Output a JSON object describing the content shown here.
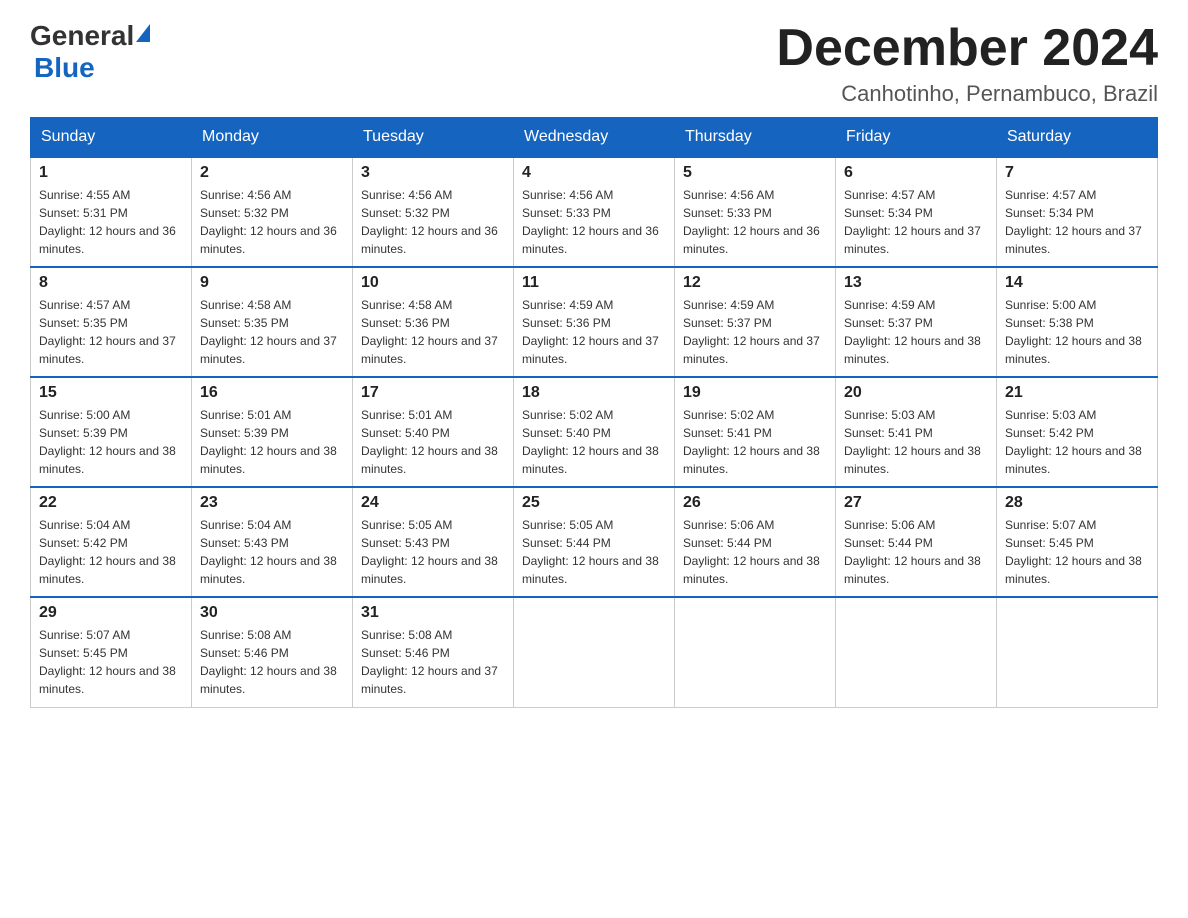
{
  "header": {
    "logo_general": "General",
    "logo_blue": "Blue",
    "month_title": "December 2024",
    "location": "Canhotinho, Pernambuco, Brazil"
  },
  "days_of_week": [
    "Sunday",
    "Monday",
    "Tuesday",
    "Wednesday",
    "Thursday",
    "Friday",
    "Saturday"
  ],
  "weeks": [
    [
      {
        "day": "1",
        "sunrise": "Sunrise: 4:55 AM",
        "sunset": "Sunset: 5:31 PM",
        "daylight": "Daylight: 12 hours and 36 minutes."
      },
      {
        "day": "2",
        "sunrise": "Sunrise: 4:56 AM",
        "sunset": "Sunset: 5:32 PM",
        "daylight": "Daylight: 12 hours and 36 minutes."
      },
      {
        "day": "3",
        "sunrise": "Sunrise: 4:56 AM",
        "sunset": "Sunset: 5:32 PM",
        "daylight": "Daylight: 12 hours and 36 minutes."
      },
      {
        "day": "4",
        "sunrise": "Sunrise: 4:56 AM",
        "sunset": "Sunset: 5:33 PM",
        "daylight": "Daylight: 12 hours and 36 minutes."
      },
      {
        "day": "5",
        "sunrise": "Sunrise: 4:56 AM",
        "sunset": "Sunset: 5:33 PM",
        "daylight": "Daylight: 12 hours and 36 minutes."
      },
      {
        "day": "6",
        "sunrise": "Sunrise: 4:57 AM",
        "sunset": "Sunset: 5:34 PM",
        "daylight": "Daylight: 12 hours and 37 minutes."
      },
      {
        "day": "7",
        "sunrise": "Sunrise: 4:57 AM",
        "sunset": "Sunset: 5:34 PM",
        "daylight": "Daylight: 12 hours and 37 minutes."
      }
    ],
    [
      {
        "day": "8",
        "sunrise": "Sunrise: 4:57 AM",
        "sunset": "Sunset: 5:35 PM",
        "daylight": "Daylight: 12 hours and 37 minutes."
      },
      {
        "day": "9",
        "sunrise": "Sunrise: 4:58 AM",
        "sunset": "Sunset: 5:35 PM",
        "daylight": "Daylight: 12 hours and 37 minutes."
      },
      {
        "day": "10",
        "sunrise": "Sunrise: 4:58 AM",
        "sunset": "Sunset: 5:36 PM",
        "daylight": "Daylight: 12 hours and 37 minutes."
      },
      {
        "day": "11",
        "sunrise": "Sunrise: 4:59 AM",
        "sunset": "Sunset: 5:36 PM",
        "daylight": "Daylight: 12 hours and 37 minutes."
      },
      {
        "day": "12",
        "sunrise": "Sunrise: 4:59 AM",
        "sunset": "Sunset: 5:37 PM",
        "daylight": "Daylight: 12 hours and 37 minutes."
      },
      {
        "day": "13",
        "sunrise": "Sunrise: 4:59 AM",
        "sunset": "Sunset: 5:37 PM",
        "daylight": "Daylight: 12 hours and 38 minutes."
      },
      {
        "day": "14",
        "sunrise": "Sunrise: 5:00 AM",
        "sunset": "Sunset: 5:38 PM",
        "daylight": "Daylight: 12 hours and 38 minutes."
      }
    ],
    [
      {
        "day": "15",
        "sunrise": "Sunrise: 5:00 AM",
        "sunset": "Sunset: 5:39 PM",
        "daylight": "Daylight: 12 hours and 38 minutes."
      },
      {
        "day": "16",
        "sunrise": "Sunrise: 5:01 AM",
        "sunset": "Sunset: 5:39 PM",
        "daylight": "Daylight: 12 hours and 38 minutes."
      },
      {
        "day": "17",
        "sunrise": "Sunrise: 5:01 AM",
        "sunset": "Sunset: 5:40 PM",
        "daylight": "Daylight: 12 hours and 38 minutes."
      },
      {
        "day": "18",
        "sunrise": "Sunrise: 5:02 AM",
        "sunset": "Sunset: 5:40 PM",
        "daylight": "Daylight: 12 hours and 38 minutes."
      },
      {
        "day": "19",
        "sunrise": "Sunrise: 5:02 AM",
        "sunset": "Sunset: 5:41 PM",
        "daylight": "Daylight: 12 hours and 38 minutes."
      },
      {
        "day": "20",
        "sunrise": "Sunrise: 5:03 AM",
        "sunset": "Sunset: 5:41 PM",
        "daylight": "Daylight: 12 hours and 38 minutes."
      },
      {
        "day": "21",
        "sunrise": "Sunrise: 5:03 AM",
        "sunset": "Sunset: 5:42 PM",
        "daylight": "Daylight: 12 hours and 38 minutes."
      }
    ],
    [
      {
        "day": "22",
        "sunrise": "Sunrise: 5:04 AM",
        "sunset": "Sunset: 5:42 PM",
        "daylight": "Daylight: 12 hours and 38 minutes."
      },
      {
        "day": "23",
        "sunrise": "Sunrise: 5:04 AM",
        "sunset": "Sunset: 5:43 PM",
        "daylight": "Daylight: 12 hours and 38 minutes."
      },
      {
        "day": "24",
        "sunrise": "Sunrise: 5:05 AM",
        "sunset": "Sunset: 5:43 PM",
        "daylight": "Daylight: 12 hours and 38 minutes."
      },
      {
        "day": "25",
        "sunrise": "Sunrise: 5:05 AM",
        "sunset": "Sunset: 5:44 PM",
        "daylight": "Daylight: 12 hours and 38 minutes."
      },
      {
        "day": "26",
        "sunrise": "Sunrise: 5:06 AM",
        "sunset": "Sunset: 5:44 PM",
        "daylight": "Daylight: 12 hours and 38 minutes."
      },
      {
        "day": "27",
        "sunrise": "Sunrise: 5:06 AM",
        "sunset": "Sunset: 5:44 PM",
        "daylight": "Daylight: 12 hours and 38 minutes."
      },
      {
        "day": "28",
        "sunrise": "Sunrise: 5:07 AM",
        "sunset": "Sunset: 5:45 PM",
        "daylight": "Daylight: 12 hours and 38 minutes."
      }
    ],
    [
      {
        "day": "29",
        "sunrise": "Sunrise: 5:07 AM",
        "sunset": "Sunset: 5:45 PM",
        "daylight": "Daylight: 12 hours and 38 minutes."
      },
      {
        "day": "30",
        "sunrise": "Sunrise: 5:08 AM",
        "sunset": "Sunset: 5:46 PM",
        "daylight": "Daylight: 12 hours and 38 minutes."
      },
      {
        "day": "31",
        "sunrise": "Sunrise: 5:08 AM",
        "sunset": "Sunset: 5:46 PM",
        "daylight": "Daylight: 12 hours and 37 minutes."
      },
      null,
      null,
      null,
      null
    ]
  ]
}
